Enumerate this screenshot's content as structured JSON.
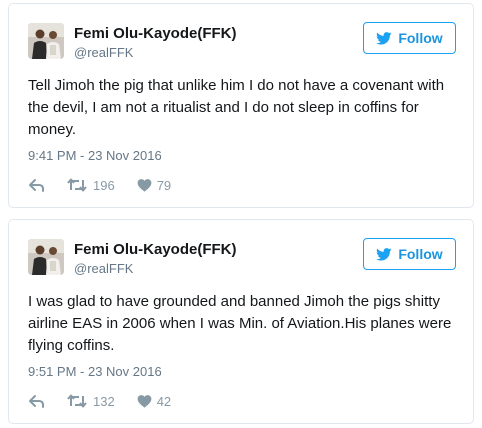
{
  "tweets": [
    {
      "author": {
        "name": "Femi Olu-Kayode(FFK)",
        "handle": "@realFFK"
      },
      "follow_label": "Follow",
      "text": "Tell Jimoh the pig that unlike him I do not have a covenant with the devil, I am not a ritualist and I do not sleep in coffins for money.",
      "timestamp": "9:41 PM - 23 Nov 2016",
      "retweets": "196",
      "likes": "79"
    },
    {
      "author": {
        "name": "Femi Olu-Kayode(FFK)",
        "handle": "@realFFK"
      },
      "follow_label": "Follow",
      "text": "I was glad to have grounded and banned Jimoh the pigs shitty airline EAS in 2006 when I was Min. of Aviation.His planes were flying coffins.",
      "timestamp": "9:51 PM - 23 Nov 2016",
      "retweets": "132",
      "likes": "42"
    }
  ],
  "icons": {
    "follow": "twitter-bird-icon",
    "reply": "reply-icon",
    "retweet": "retweet-icon",
    "like": "heart-icon"
  },
  "colors": {
    "accent": "#1da1f2",
    "text": "#14171a",
    "muted": "#657786",
    "action": "#8899a6",
    "border": "#e1e8ed"
  }
}
